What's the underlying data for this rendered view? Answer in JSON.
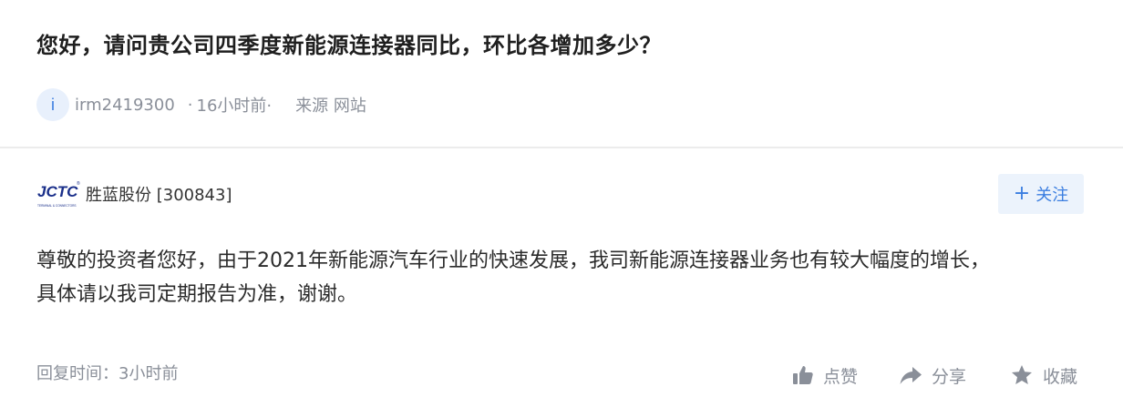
{
  "question": {
    "title": "您好，请问贵公司四季度新能源连接器同比，环比各增加多少？"
  },
  "meta": {
    "avatar_letter": "i",
    "username": "irm2419300",
    "separator": "·",
    "time": "16小时前·",
    "source": "来源 网站"
  },
  "company": {
    "logo_text": "JCTC",
    "logo_subtext": "TERMINAL & CONNECTORS",
    "name": "胜蓝股份 [300843]"
  },
  "follow": {
    "plus": "+",
    "label": "关注"
  },
  "answer": {
    "line1": "尊敬的投资者您好，由于2021年新能源汽车行业的快速发展，我司新能源连接器业务也有较大幅度的增长，",
    "line2": "具体请以我司定期报告为准，谢谢。",
    "reply_time": "回复时间：3小时前"
  },
  "actions": {
    "like": "点赞",
    "share": "分享",
    "favorite": "收藏"
  },
  "colors": {
    "accent": "#3b7ee0",
    "muted": "#8a8f99",
    "follow_bg": "#ecf3fc",
    "logo_blue": "#1a2f8a"
  }
}
